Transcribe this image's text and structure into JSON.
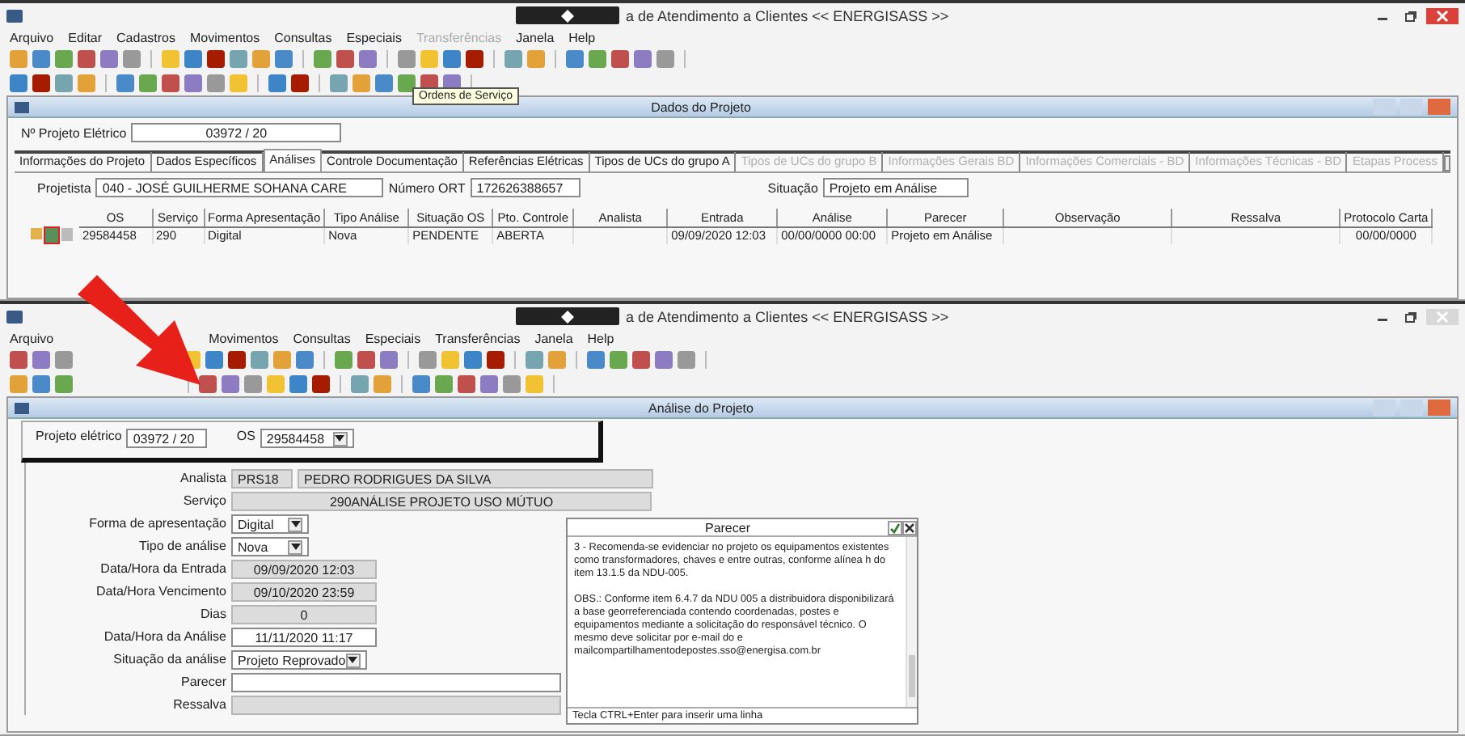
{
  "windows": [
    {
      "title": "a de Atendimento a Clientes << ENERGISASS >>",
      "active": true,
      "menu": [
        {
          "label": "Arquivo",
          "disabled": false
        },
        {
          "label": "Editar",
          "disabled": false
        },
        {
          "label": "Cadastros",
          "disabled": false
        },
        {
          "label": "Movimentos",
          "disabled": false
        },
        {
          "label": "Consultas",
          "disabled": false
        },
        {
          "label": "Especiais",
          "disabled": false
        },
        {
          "label": "Transferências",
          "disabled": true
        },
        {
          "label": "Janela",
          "disabled": false
        },
        {
          "label": "Help",
          "disabled": false
        }
      ],
      "tooltip": "Ordens de Serviço"
    },
    {
      "title": "a de Atendimento a Clientes << ENERGISASS >>",
      "active": false,
      "menu": [
        {
          "label": "Arquivo",
          "disabled": false
        },
        {
          "label": "Movimentos",
          "disabled": false
        },
        {
          "label": "Consultas",
          "disabled": false
        },
        {
          "label": "Especiais",
          "disabled": false
        },
        {
          "label": "Transferências",
          "disabled": false
        },
        {
          "label": "Janela",
          "disabled": false
        },
        {
          "label": "Help",
          "disabled": false
        }
      ]
    }
  ],
  "dados_projeto": {
    "title": "Dados do Projeto",
    "projeto_label": "Nº Projeto Elétrico",
    "projeto_value": "03972 / 20",
    "tabs": [
      {
        "label": "Informações do Projeto",
        "selected": false,
        "disabled": false
      },
      {
        "label": "Dados Específicos",
        "selected": false,
        "disabled": false
      },
      {
        "label": "Análises",
        "selected": true,
        "disabled": false
      },
      {
        "label": "Controle Documentação",
        "selected": false,
        "disabled": false
      },
      {
        "label": "Referências Elétricas",
        "selected": false,
        "disabled": false
      },
      {
        "label": "Tipos de UCs do grupo A",
        "selected": false,
        "disabled": false
      },
      {
        "label": "Tipos de UCs do grupo B",
        "selected": false,
        "disabled": true
      },
      {
        "label": "Informações Gerais BD",
        "selected": false,
        "disabled": true
      },
      {
        "label": "Informações Comerciais - BD",
        "selected": false,
        "disabled": true
      },
      {
        "label": "Informações Técnicas - BD",
        "selected": false,
        "disabled": true
      },
      {
        "label": "Etapas Process",
        "selected": false,
        "disabled": true
      }
    ],
    "projetista_label": "Projetista",
    "projetista_value": "040 - JOSÉ GUILHERME SOHANA CARE",
    "ort_label": "Número ORT",
    "ort_value": "172626388657",
    "situacao_label": "Situação",
    "situacao_value": "Projeto em Análise",
    "table": {
      "columns": [
        "OS",
        "Serviço",
        "Forma Apresentação",
        "Tipo Análise",
        "Situação OS",
        "Pto. Controle",
        "Analista",
        "Entrada",
        "Análise",
        "Parecer",
        "Observação",
        "Ressalva",
        "Protocolo Carta"
      ],
      "rows": [
        [
          "29584458",
          "290",
          "Digital",
          "Nova",
          "PENDENTE",
          "ABERTA",
          "",
          "09/09/2020 12:03",
          "00/00/0000 00:00",
          "Projeto em Análise",
          "",
          "",
          "00/00/0000"
        ]
      ]
    }
  },
  "analise_projeto": {
    "title": "Análise do Projeto",
    "projeto_label": "Projeto elétrico",
    "projeto_value": "03972 / 20",
    "os_label": "OS",
    "os_value": "29584458",
    "fields": [
      {
        "label": "Analista",
        "kind": "pair",
        "value": "PRS18",
        "value2": "PEDRO RODRIGUES DA SILVA",
        "disabled": true
      },
      {
        "label": "Serviço",
        "kind": "wide",
        "value": "290ANÁLISE PROJETO USO MÚTUO",
        "disabled": true
      },
      {
        "label": "Forma de apresentação",
        "kind": "dropdown",
        "value": "Digital",
        "disabled": false
      },
      {
        "label": "Tipo de análise",
        "kind": "dropdown",
        "value": "Nova",
        "disabled": false
      },
      {
        "label": "Data/Hora da Entrada",
        "kind": "text",
        "value": "09/09/2020 12:03",
        "disabled": true
      },
      {
        "label": "Data/Hora Vencimento",
        "kind": "text",
        "value": "09/10/2020 23:59",
        "disabled": true
      },
      {
        "label": "Dias",
        "kind": "text",
        "value": "0",
        "disabled": true
      },
      {
        "label": "Data/Hora da Análise",
        "kind": "text",
        "value": "11/11/2020 11:17",
        "disabled": false
      },
      {
        "label": "Situação da análise",
        "kind": "dropdown",
        "value": "Projeto Reprovado",
        "disabled": false
      },
      {
        "label": "Parecer",
        "kind": "long",
        "disabled": false
      },
      {
        "label": "Ressalva",
        "kind": "long",
        "disabled": true
      }
    ]
  },
  "parecer_popup": {
    "title": "Parecer",
    "paragraphs": [
      "3 - Recomenda-se evidenciar no projeto os equipamentos existentes como transformadores, chaves e entre outras, conforme alínea h do item 13.1.5 da NDU-005.",
      "OBS.: Conforme item 6.4.7 da NDU 005 a distribuidora disponibilizará a base georreferenciada contendo coordenadas, postes e equipamentos mediante a solicitação do responsável técnico. O mesmo deve solicitar por e-mail do e mailcompartilhamentodepostes.sso@energisa.com.br"
    ],
    "hint": "Tecla CTRL+Enter para inserir uma linha"
  }
}
